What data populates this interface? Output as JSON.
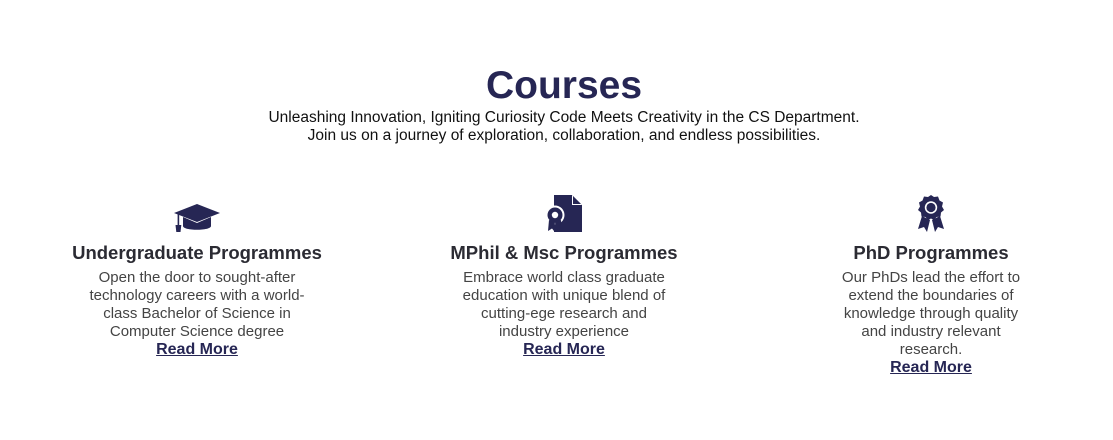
{
  "header": {
    "title": "Courses",
    "subtitle_line1": "Unleashing Innovation, Igniting Curiosity Code Meets Creativity in the CS Department.",
    "subtitle_line2": "Join us on a journey of exploration, collaboration, and endless possibilities."
  },
  "colors": {
    "accent": "#262654",
    "heading": "#2b2b33",
    "body": "#444444"
  },
  "courses": [
    {
      "icon": "graduation-cap-icon",
      "title": "Undergraduate Programmes",
      "description": "Open the door to sought-after technology careers with a world-class Bachelor of Science in Computer Science degree",
      "link": "Read More"
    },
    {
      "icon": "certificate-file-icon",
      "title": "MPhil & Msc Programmes",
      "description": "Embrace world class graduate education with unique blend of cutting-ege research and industry experience",
      "link": "Read More"
    },
    {
      "icon": "award-ribbon-icon",
      "title": "PhD Programmes",
      "description": "Our PhDs lead the effort to extend the boundaries of knowledge through quality and industry relevant research.",
      "link": "Read More"
    }
  ]
}
